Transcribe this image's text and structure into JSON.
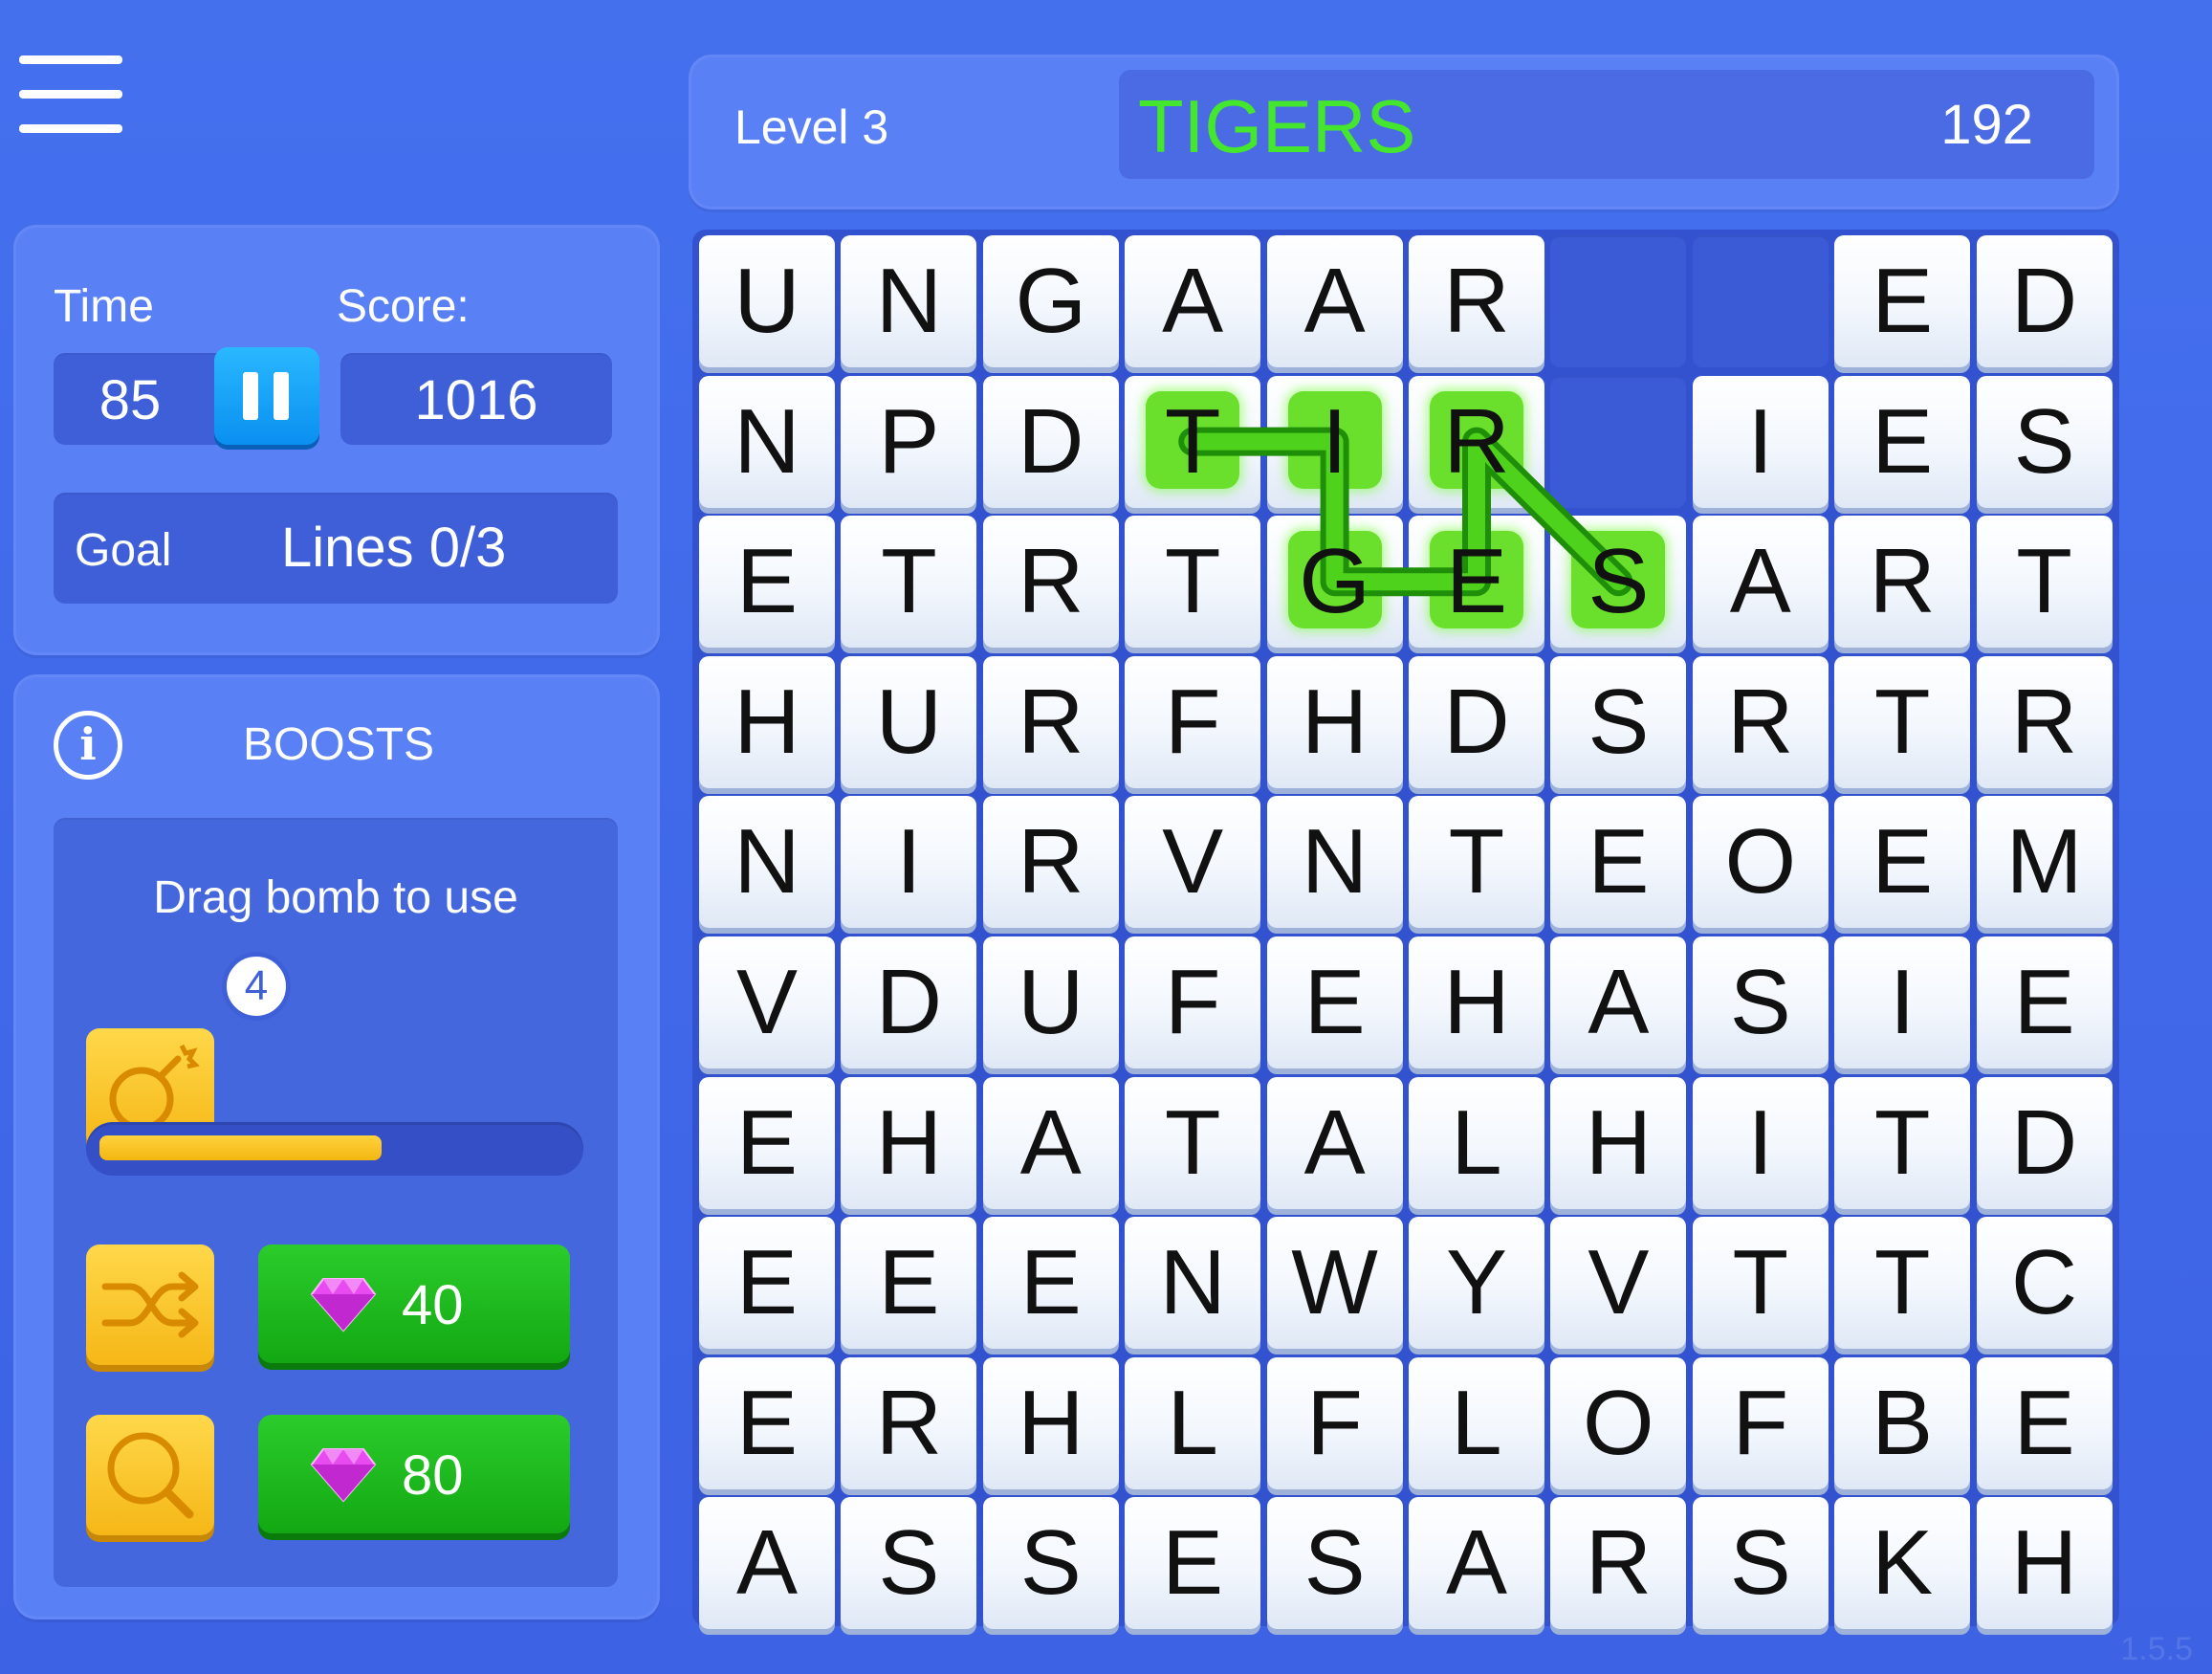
{
  "header": {
    "level": "Level 3",
    "current_word": "TIGERS",
    "word_points": "192"
  },
  "stats": {
    "time_label": "Time",
    "time_value": "85",
    "score_label": "Score:",
    "score_value": "1016",
    "goal_label": "Goal",
    "goal_value": "Lines 0/3"
  },
  "boosts": {
    "title": "BOOSTS",
    "hint": "Drag bomb to use",
    "bomb_count": "4",
    "bomb_progress": 0.6,
    "shuffle_price": "40",
    "search_price": "80"
  },
  "board": {
    "rows": [
      [
        "U",
        "N",
        "G",
        "A",
        "A",
        "R",
        "",
        "",
        "E",
        "D"
      ],
      [
        "N",
        "P",
        "D",
        "T",
        "I",
        "R",
        "",
        "I",
        "E",
        "S"
      ],
      [
        "E",
        "T",
        "R",
        "T",
        "G",
        "E",
        "S",
        "A",
        "R",
        "T"
      ],
      [
        "H",
        "U",
        "R",
        "F",
        "H",
        "D",
        "S",
        "R",
        "T",
        "R"
      ],
      [
        "N",
        "I",
        "R",
        "V",
        "N",
        "T",
        "E",
        "O",
        "E",
        "M"
      ],
      [
        "V",
        "D",
        "U",
        "F",
        "E",
        "H",
        "A",
        "S",
        "I",
        "E"
      ],
      [
        "E",
        "H",
        "A",
        "T",
        "A",
        "L",
        "H",
        "I",
        "T",
        "D"
      ],
      [
        "E",
        "E",
        "E",
        "N",
        "W",
        "Y",
        "V",
        "T",
        "T",
        "C"
      ],
      [
        "E",
        "R",
        "H",
        "L",
        "F",
        "L",
        "O",
        "F",
        "B",
        "E"
      ],
      [
        "A",
        "S",
        "S",
        "E",
        "S",
        "A",
        "R",
        "S",
        "K",
        "H"
      ]
    ],
    "selected_path": [
      [
        1,
        3
      ],
      [
        1,
        4
      ],
      [
        2,
        4
      ],
      [
        2,
        5
      ],
      [
        1,
        5
      ],
      [
        2,
        6
      ]
    ]
  },
  "version": "1.5.5",
  "colors": {
    "background": "#4068ea",
    "word_text": "#45e62e",
    "selection": "#3fc41a",
    "pause_button": "#1aa4fb",
    "boost_yellow": "#f8c62a",
    "buy_green": "#1fba1f"
  },
  "icons": [
    "menu-icon",
    "pause-icon",
    "info-icon",
    "bomb-icon",
    "shuffle-icon",
    "magnifier-icon",
    "gem-icon"
  ]
}
